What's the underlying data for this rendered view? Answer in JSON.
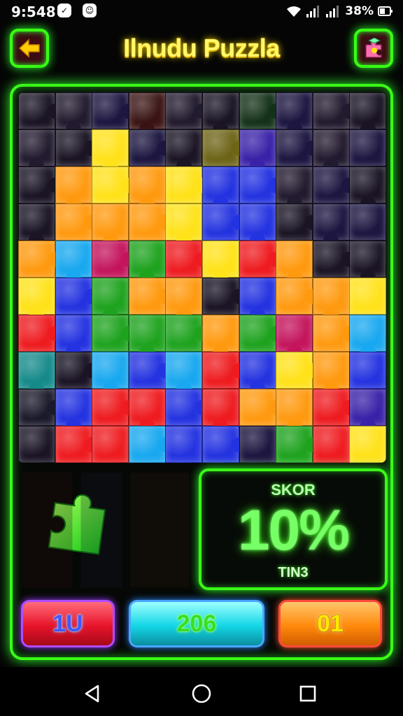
{
  "status_bar": {
    "time": "9:548",
    "battery": "38%"
  },
  "header": {
    "title": "Ilnudu Puzzla"
  },
  "score": {
    "label": "SKOR",
    "value": "10%",
    "sub": "TIN3"
  },
  "buttons": {
    "left": "1U",
    "middle": "206",
    "right": "01"
  },
  "colors": {
    "neon_green": "#39ff14",
    "title_yellow": "#fff86a"
  },
  "icons": {
    "back": "arrow-left-icon",
    "hint": "puzzle-hint-icon",
    "nav_back": "triangle-back-icon",
    "nav_home": "circle-home-icon",
    "nav_recent": "square-recent-icon"
  }
}
